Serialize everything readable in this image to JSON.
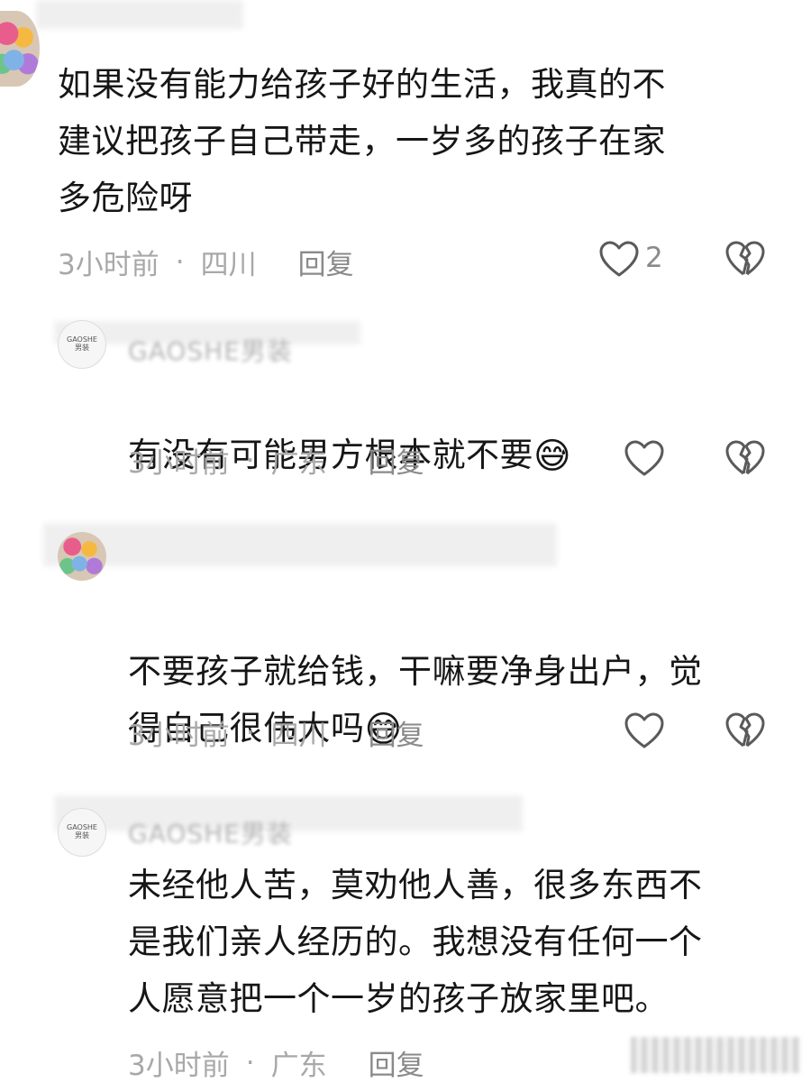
{
  "comments": [
    {
      "text": "如果没有能力给孩子好的生活，我真的不\n建议把孩子自己带走，一岁多的孩子在家\n多危险呀",
      "time": "3小时前",
      "location": "四川",
      "reply_label": "回复",
      "likes": "2"
    },
    {
      "username": "GAOSHE男装",
      "text": "有没有可能男方根本就不要",
      "emoji": "😅",
      "time": "3小时前",
      "location": "广东",
      "reply_label": "回复"
    },
    {
      "text": "不要孩子就给钱，干嘛要净身出户，觉\n得自己很伟大吗",
      "emoji": "😅",
      "time": "3小时前",
      "location": "四川",
      "reply_label": "回复"
    },
    {
      "username": "GAOSHE男装",
      "text": "未经他人苦，莫劝他人善，很多东西不\n是我们亲人经历的。我想没有任何一个\n人愿意把一个一岁的孩子放家里吧。",
      "time": "3小时前",
      "location": "广东",
      "reply_label": "回复"
    }
  ],
  "avatar_brand_text": [
    "GAOSHE",
    "男装"
  ],
  "icons": {
    "like": "heart-outline-icon",
    "dislike": "broken-heart-icon",
    "reply_arrow": "triangle-right-icon"
  },
  "colors": {
    "text": "#161616",
    "meta": "#a8a8a8",
    "icon": "#5a5a5a"
  }
}
